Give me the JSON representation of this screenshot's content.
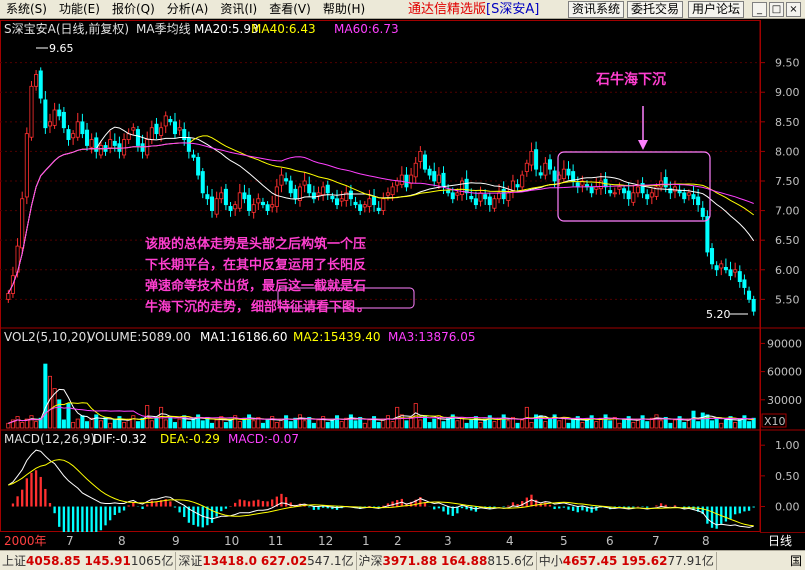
{
  "menu": [
    "系统(S)",
    "功能(E)",
    "报价(Q)",
    "分析(A)",
    "资讯(I)",
    "查看(V)",
    "帮助(H)"
  ],
  "brand": "通达信精选版",
  "stock_tag": "[S深安A]",
  "buttons": [
    "资讯系统",
    "委托交易",
    "用户论坛"
  ],
  "window_controls": [
    "_",
    "□",
    "×"
  ],
  "price_panel": {
    "name": "S深宝安A(日线,前复权)",
    "indicator": "MA季均线",
    "ma20": "MA20:5.93",
    "ma40": "MA40:6.43",
    "ma60": "MA60:6.73",
    "high_mark": "9.65",
    "low_mark": "5.20"
  },
  "volume_panel": {
    "name": "VOL2(5,10,20)",
    "volume": "VOLUME:5089.00",
    "ma1": "MA1:16186.60",
    "ma2": "MA2:15439.40",
    "ma3": "MA3:13876.05",
    "scale": "X10"
  },
  "macd_panel": {
    "name": "MACD(12,26,9)",
    "dif": "DIF:-0.32",
    "dea": "DEA:-0.29",
    "macd": "MACD:-0.07"
  },
  "annotation": {
    "title": "石牛海下沉",
    "line1": "该股的总体走势是头部之后构筑一个压",
    "line2": "下长期平台，在其中反复运用了长阳反",
    "line3": "弹速命等技术出货，最后这一截就是石",
    "line4a": "牛海下沉的走势，",
    "line4b": "细部特征请看下图",
    "line4c": "。"
  },
  "date_axis": [
    "2000年",
    "7",
    "8",
    "9",
    "10",
    "11",
    "12",
    "1",
    "2",
    "3",
    "4",
    "5",
    "6",
    "7",
    "8"
  ],
  "period_tab": "日线",
  "status": {
    "sh_label": "上证",
    "sh_value": "4058.85",
    "sh_change": "145.91",
    "sh_amount": "1065亿",
    "sz_label": "深证",
    "sz_value": "13418.0",
    "sz_change": "627.02",
    "sz_amount": "547.1亿",
    "hs_label": "沪深",
    "hs_value": "3971.88",
    "hs_change": "164.88",
    "hs_amount": "815.6亿",
    "zx_label": "中小",
    "zx_value": "4657.45",
    "zx_change": "195.62",
    "zx_amount": "77.91亿",
    "trailing": "国"
  },
  "chart_data": {
    "type": "candlestick",
    "price_axis": {
      "ticks": [
        9.5,
        9.0,
        8.5,
        8.0,
        7.5,
        7.0,
        6.5,
        6.0,
        5.5
      ],
      "ylim": [
        5.05,
        9.95
      ]
    },
    "volume_axis": {
      "ticks": [
        "90000",
        "60000",
        "30000"
      ],
      "ylim": [
        0,
        100000
      ]
    },
    "macd_axis": {
      "ticks": [
        "1.00",
        "0.50",
        "0.00"
      ],
      "ylim": [
        -0.35,
        1.15
      ]
    },
    "closes": [
      5.6,
      5.9,
      6.4,
      7.2,
      8.3,
      9.1,
      9.3,
      8.9,
      8.4,
      8.5,
      8.7,
      8.6,
      8.4,
      8.2,
      8.3,
      8.5,
      8.3,
      8.1,
      8.2,
      8.0,
      8.1,
      8.0,
      8.2,
      8.1,
      8.0,
      8.2,
      8.3,
      8.4,
      8.1,
      8.0,
      8.2,
      8.4,
      8.3,
      8.4,
      8.6,
      8.5,
      8.3,
      8.4,
      8.2,
      8.0,
      7.9,
      7.6,
      7.3,
      7.2,
      7.0,
      7.2,
      7.3,
      7.1,
      7.0,
      7.1,
      7.3,
      7.2,
      7.0,
      7.1,
      7.2,
      7.1,
      7.0,
      7.1,
      7.4,
      7.6,
      7.5,
      7.3,
      7.2,
      7.4,
      7.5,
      7.3,
      7.2,
      7.3,
      7.4,
      7.3,
      7.2,
      7.1,
      7.2,
      7.3,
      7.2,
      7.1,
      7.0,
      7.1,
      7.2,
      7.1,
      7.0,
      7.2,
      7.3,
      7.4,
      7.5,
      7.6,
      7.4,
      7.6,
      7.8,
      8.0,
      7.7,
      7.6,
      7.5,
      7.6,
      7.4,
      7.3,
      7.2,
      7.3,
      7.5,
      7.3,
      7.2,
      7.1,
      7.3,
      7.2,
      7.1,
      7.2,
      7.3,
      7.2,
      7.3,
      7.5,
      7.4,
      7.6,
      7.8,
      8.0,
      7.7,
      7.6,
      7.8,
      7.7,
      7.5,
      7.6,
      7.7,
      7.6,
      7.5,
      7.4,
      7.5,
      7.4,
      7.3,
      7.4,
      7.5,
      7.4,
      7.3,
      7.3,
      7.4,
      7.3,
      7.2,
      7.3,
      7.4,
      7.3,
      7.2,
      7.3,
      7.4,
      7.5,
      7.4,
      7.3,
      7.4,
      7.3,
      7.2,
      7.3,
      7.2,
      7.1,
      6.9,
      6.3,
      6.1,
      6.0,
      6.1,
      6.0,
      5.9,
      6.0,
      5.8,
      5.7,
      5.5,
      5.3
    ],
    "vol_spikes": {
      "8": 68000,
      "9": 55000,
      "10": 42000,
      "11": 30000,
      "13": 26000,
      "30": 24000,
      "33": 22000,
      "84": 22000,
      "88": 26000,
      "112": 22000,
      "114": 14000,
      "148": 18000,
      "150": 16000
    },
    "macd_values": [
      0.35,
      0.4,
      0.5,
      0.6,
      0.75,
      0.85,
      0.92,
      0.9,
      0.82,
      0.75,
      0.7,
      0.6,
      0.5,
      0.42,
      0.36,
      0.3,
      0.22,
      0.18,
      0.14,
      0.1,
      0.06,
      0.05,
      0.05,
      0.06,
      0.05,
      0.05,
      0.08,
      0.1,
      0.06,
      0.04,
      0.08,
      0.12,
      0.12,
      0.14,
      0.16,
      0.15,
      0.1,
      0.06,
      0.02,
      -0.04,
      -0.08,
      -0.12,
      -0.16,
      -0.18,
      -0.2,
      -0.18,
      -0.16,
      -0.16,
      -0.15,
      -0.13,
      -0.1,
      -0.1,
      -0.1,
      -0.08,
      -0.06,
      -0.06,
      -0.05,
      -0.02,
      0.02,
      0.06,
      0.05,
      0.02,
      0.01,
      0.03,
      0.04,
      0.02,
      0.0,
      0.0,
      0.01,
      0.0,
      -0.01,
      -0.02,
      -0.01,
      0.0,
      -0.01,
      -0.02,
      -0.03,
      -0.02,
      -0.01,
      -0.02,
      -0.03,
      -0.01,
      0.01,
      0.03,
      0.05,
      0.07,
      0.04,
      0.06,
      0.09,
      0.13,
      0.1,
      0.07,
      0.05,
      0.06,
      0.03,
      0.0,
      -0.02,
      -0.01,
      0.02,
      0.0,
      -0.02,
      -0.04,
      -0.02,
      -0.03,
      -0.04,
      -0.03,
      -0.02,
      -0.03,
      -0.02,
      0.01,
      0.0,
      0.03,
      0.07,
      0.11,
      0.08,
      0.06,
      0.08,
      0.07,
      0.04,
      0.05,
      0.06,
      0.04,
      0.02,
      0.0,
      0.01,
      -0.01,
      -0.03,
      -0.02,
      0.0,
      -0.01,
      -0.03,
      -0.03,
      -0.02,
      -0.03,
      -0.04,
      -0.03,
      -0.02,
      -0.03,
      -0.04,
      -0.03,
      -0.02,
      0.0,
      -0.01,
      -0.02,
      -0.01,
      -0.02,
      -0.04,
      -0.03,
      -0.05,
      -0.07,
      -0.1,
      -0.2,
      -0.26,
      -0.3,
      -0.29,
      -0.3,
      -0.31,
      -0.3,
      -0.32,
      -0.33,
      -0.34,
      -0.32
    ]
  }
}
